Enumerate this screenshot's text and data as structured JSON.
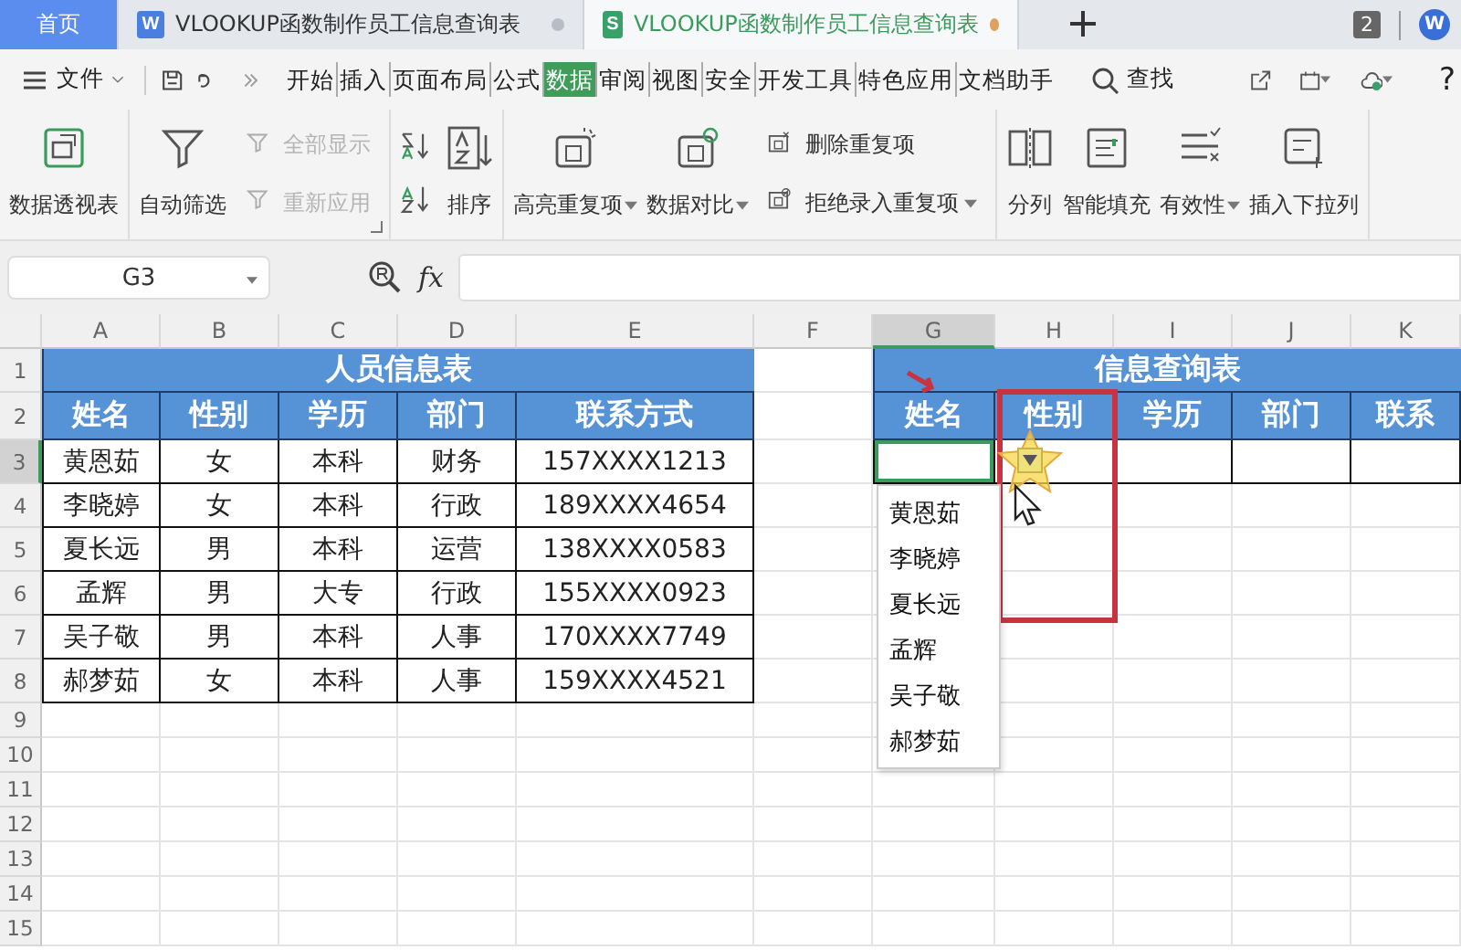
{
  "tabs": [
    {
      "label": "首页",
      "selected": false,
      "kind": "home"
    },
    {
      "label": "VLOOKUP函数制作员工信息查询表",
      "selected": false,
      "kind": "doc",
      "app": "W",
      "modified": true
    },
    {
      "label": "VLOOKUP函数制作员工信息查询表",
      "selected": true,
      "kind": "sheet",
      "app": "S",
      "modified": true
    }
  ],
  "window_count": "2",
  "account_initial": "W",
  "menu": {
    "file": "文件",
    "tabs": [
      {
        "label": "开始",
        "selected": false
      },
      {
        "label": "插入",
        "selected": false
      },
      {
        "label": "页面布局",
        "selected": false
      },
      {
        "label": "公式",
        "selected": false
      },
      {
        "label": "数据",
        "selected": true
      },
      {
        "label": "审阅",
        "selected": false
      },
      {
        "label": "视图",
        "selected": false
      },
      {
        "label": "安全",
        "selected": false
      },
      {
        "label": "开发工具",
        "selected": false
      },
      {
        "label": "特色应用",
        "selected": false
      },
      {
        "label": "文档助手",
        "selected": false
      }
    ],
    "search": "查找",
    "help": "?"
  },
  "ribbon": {
    "groups": [
      {
        "items": [
          {
            "kind": "large",
            "label": "数据透视表",
            "dropdown": false,
            "disabled": false
          }
        ]
      },
      {
        "launcher": true,
        "items": [
          {
            "kind": "large",
            "label": "自动筛选",
            "dropdown": false,
            "disabled": false
          },
          {
            "kind": "stack",
            "items": [
              {
                "label": "全部显示",
                "dropdown": false,
                "disabled": true
              },
              {
                "label": "重新应用",
                "dropdown": false,
                "disabled": true
              }
            ]
          }
        ]
      },
      {
        "items": [
          {
            "kind": "sort_pair"
          },
          {
            "kind": "large",
            "label": "排序",
            "dropdown": false,
            "disabled": false
          }
        ]
      },
      {
        "items": [
          {
            "kind": "large",
            "label": "高亮重复项",
            "dropdown": true,
            "disabled": false
          },
          {
            "kind": "large",
            "label": "数据对比",
            "dropdown": true,
            "disabled": false
          },
          {
            "kind": "stack",
            "items": [
              {
                "label": "删除重复项",
                "dropdown": false,
                "disabled": false
              },
              {
                "label": "拒绝录入重复项",
                "dropdown": true,
                "disabled": false
              }
            ]
          }
        ]
      },
      {
        "items": [
          {
            "kind": "large",
            "label": "分列",
            "dropdown": false,
            "disabled": false
          },
          {
            "kind": "large",
            "label": "智能填充",
            "dropdown": false,
            "disabled": false
          },
          {
            "kind": "large",
            "label": "有效性",
            "dropdown": true,
            "disabled": false
          },
          {
            "kind": "large",
            "label": "插入下拉列",
            "dropdown": false,
            "disabled": false
          }
        ]
      }
    ]
  },
  "formula_bar": {
    "name_box": "G3",
    "fx": "fx"
  },
  "sheet": {
    "columns": [
      {
        "label": "A",
        "selected": false
      },
      {
        "label": "B",
        "selected": false
      },
      {
        "label": "C",
        "selected": false
      },
      {
        "label": "D",
        "selected": false
      },
      {
        "label": "E",
        "selected": false
      },
      {
        "label": "F",
        "selected": false
      },
      {
        "label": "G",
        "selected": true
      },
      {
        "label": "H",
        "selected": false
      },
      {
        "label": "I",
        "selected": false
      },
      {
        "label": "J",
        "selected": false
      },
      {
        "label": "K",
        "selected": false
      }
    ],
    "rows": [
      {
        "label": "1",
        "selected": false
      },
      {
        "label": "2",
        "selected": false
      },
      {
        "label": "3",
        "selected": true
      },
      {
        "label": "4",
        "selected": false
      },
      {
        "label": "5",
        "selected": false
      },
      {
        "label": "6",
        "selected": false
      },
      {
        "label": "7",
        "selected": false
      },
      {
        "label": "8",
        "selected": false
      },
      {
        "label": "9",
        "selected": false
      },
      {
        "label": "10",
        "selected": false
      },
      {
        "label": "11",
        "selected": false
      },
      {
        "label": "12",
        "selected": false
      },
      {
        "label": "13",
        "selected": false
      },
      {
        "label": "14",
        "selected": false
      },
      {
        "label": "15",
        "selected": false
      }
    ],
    "tables": [
      {
        "title": "人员信息表",
        "headers": [
          "姓名",
          "性别",
          "学历",
          "部门",
          "联系方式"
        ],
        "rows": [
          [
            "黄恩茹",
            "女",
            "本科",
            "财务",
            "157XXXX1213"
          ],
          [
            "李晓婷",
            "女",
            "本科",
            "行政",
            "189XXXX4654"
          ],
          [
            "夏长远",
            "男",
            "本科",
            "运营",
            "138XXXX0583"
          ],
          [
            "孟辉",
            "男",
            "大专",
            "行政",
            "155XXXX0923"
          ],
          [
            "吴子敬",
            "男",
            "本科",
            "人事",
            "170XXXX7749"
          ],
          [
            "郝梦茹",
            "女",
            "本科",
            "人事",
            "159XXXX4521"
          ]
        ]
      },
      {
        "title": "信息查询表",
        "headers": [
          "姓名",
          "性别",
          "学历",
          "部门",
          "联系"
        ]
      }
    ],
    "dropdown": {
      "open": true,
      "items": [
        {
          "label": "黄恩茹",
          "selected": false
        },
        {
          "label": "李晓婷",
          "selected": false
        },
        {
          "label": "夏长远",
          "selected": false
        },
        {
          "label": "孟辉",
          "selected": false
        },
        {
          "label": "吴子敬",
          "selected": false
        },
        {
          "label": "郝梦茹",
          "selected": false
        }
      ]
    }
  }
}
